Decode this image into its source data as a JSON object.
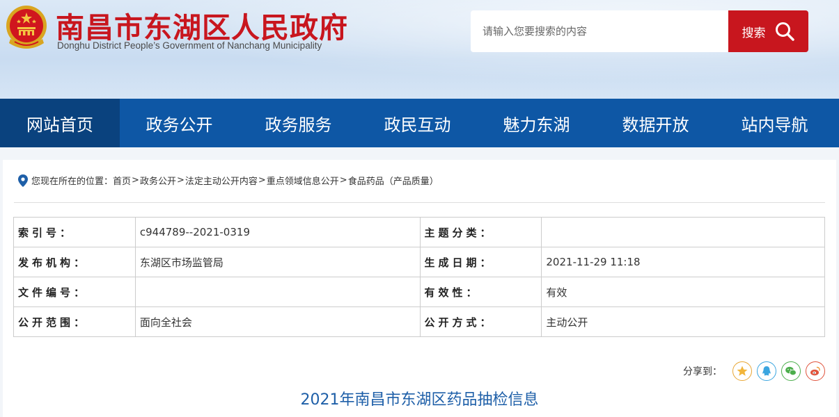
{
  "header": {
    "title": "南昌市东湖区人民政府",
    "subtitle": "Donghu District  People’s Government of Nanchang  Municipality"
  },
  "search": {
    "placeholder": "请输入您要搜索的内容",
    "button_label": "搜索"
  },
  "nav": {
    "items": [
      "网站首页",
      "政务公开",
      "政务服务",
      "政民互动",
      "魅力东湖",
      "数据开放",
      "站内导航"
    ]
  },
  "breadcrumb": {
    "prefix": "您现在所在的位置：",
    "items": [
      "首页",
      "政务公开",
      "法定主动公开内容",
      "重点领域信息公开",
      "食品药品（产品质量）"
    ]
  },
  "meta": {
    "rows": [
      {
        "k1": "索引号：",
        "v1": "c944789--2021-0319",
        "k2": "主题分类：",
        "v2": ""
      },
      {
        "k1": "发布机构：",
        "v1": "东湖区市场监管局",
        "k2": "生成日期：",
        "v2": "2021-11-29 11:18"
      },
      {
        "k1": "文件编号：",
        "v1": "",
        "k2": "有效性：",
        "v2": "有效"
      },
      {
        "k1": "公开范围：",
        "v1": "面向全社会",
        "k2": "公开方式：",
        "v2": "主动公开"
      }
    ]
  },
  "share": {
    "label": "分享到：",
    "icons": [
      "star-icon",
      "qq-icon",
      "wechat-icon",
      "weibo-icon"
    ],
    "colors": {
      "star": "#e8a634",
      "qq": "#3aa5e0",
      "wechat": "#4cae4c",
      "weibo": "#e0533c"
    }
  },
  "article": {
    "title": "2021年南昌市东湖区药品抽检信息"
  },
  "colors": {
    "brand_red": "#c8161e",
    "nav_blue": "#0e57a5",
    "nav_active": "#0a427e",
    "title_blue": "#1e5fa8"
  }
}
